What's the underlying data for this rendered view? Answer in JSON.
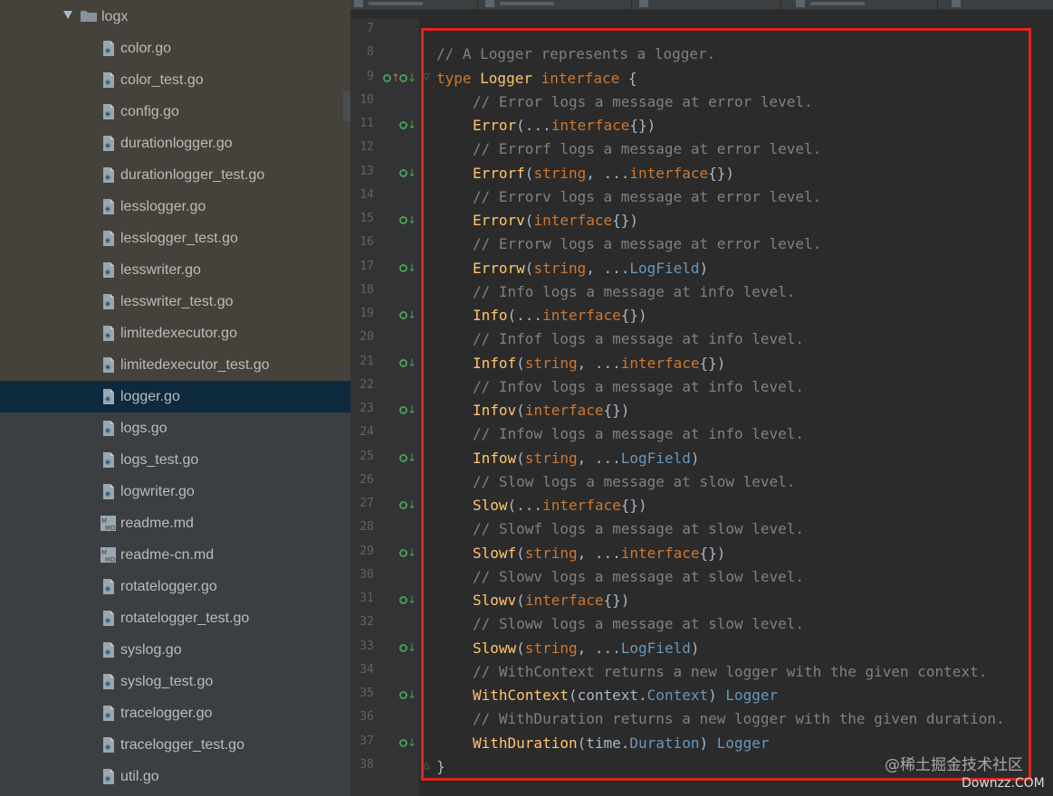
{
  "project_tree": {
    "folder": "logx",
    "selected": "logger.go",
    "files": [
      {
        "name": "color.go",
        "kind": "go"
      },
      {
        "name": "color_test.go",
        "kind": "go"
      },
      {
        "name": "config.go",
        "kind": "go"
      },
      {
        "name": "durationlogger.go",
        "kind": "go"
      },
      {
        "name": "durationlogger_test.go",
        "kind": "go"
      },
      {
        "name": "lesslogger.go",
        "kind": "go"
      },
      {
        "name": "lesslogger_test.go",
        "kind": "go"
      },
      {
        "name": "lesswriter.go",
        "kind": "go"
      },
      {
        "name": "lesswriter_test.go",
        "kind": "go"
      },
      {
        "name": "limitedexecutor.go",
        "kind": "go"
      },
      {
        "name": "limitedexecutor_test.go",
        "kind": "go"
      },
      {
        "name": "logger.go",
        "kind": "go"
      },
      {
        "name": "logs.go",
        "kind": "go"
      },
      {
        "name": "logs_test.go",
        "kind": "go"
      },
      {
        "name": "logwriter.go",
        "kind": "go"
      },
      {
        "name": "readme.md",
        "kind": "md"
      },
      {
        "name": "readme-cn.md",
        "kind": "md"
      },
      {
        "name": "rotatelogger.go",
        "kind": "go"
      },
      {
        "name": "rotatelogger_test.go",
        "kind": "go"
      },
      {
        "name": "syslog.go",
        "kind": "go"
      },
      {
        "name": "syslog_test.go",
        "kind": "go"
      },
      {
        "name": "tracelogger.go",
        "kind": "go"
      },
      {
        "name": "tracelogger_test.go",
        "kind": "go"
      },
      {
        "name": "util.go",
        "kind": "go"
      }
    ]
  },
  "editor": {
    "lines": [
      {
        "n": "7",
        "gutter": "",
        "tokens": []
      },
      {
        "n": "8",
        "gutter": "",
        "tokens": [
          {
            "t": "// A Logger represents a logger.",
            "c": "comment"
          }
        ]
      },
      {
        "n": "9",
        "gutter": "both",
        "tokens": [
          {
            "t": "type",
            "c": "keyword"
          },
          {
            "t": " Logger ",
            "c": "func"
          },
          {
            "t": "interface",
            "c": "keyword"
          },
          {
            "t": " {",
            "c": "plain"
          }
        ]
      },
      {
        "n": "10",
        "gutter": "",
        "indent": true,
        "tokens": [
          {
            "t": "// Error logs a message at error level.",
            "c": "comment"
          }
        ]
      },
      {
        "n": "11",
        "gutter": "down",
        "indent": true,
        "tokens": [
          {
            "t": "Error",
            "c": "func"
          },
          {
            "t": "(...",
            "c": "plain"
          },
          {
            "t": "interface",
            "c": "keyword"
          },
          {
            "t": "{})",
            "c": "plain"
          }
        ]
      },
      {
        "n": "12",
        "gutter": "",
        "indent": true,
        "tokens": [
          {
            "t": "// Errorf logs a message at error level.",
            "c": "comment"
          }
        ]
      },
      {
        "n": "13",
        "gutter": "down",
        "indent": true,
        "tokens": [
          {
            "t": "Errorf",
            "c": "func"
          },
          {
            "t": "(",
            "c": "plain"
          },
          {
            "t": "string",
            "c": "keyword"
          },
          {
            "t": ", ...",
            "c": "plain"
          },
          {
            "t": "interface",
            "c": "keyword"
          },
          {
            "t": "{})",
            "c": "plain"
          }
        ]
      },
      {
        "n": "14",
        "gutter": "",
        "indent": true,
        "tokens": [
          {
            "t": "// Errorv logs a message at error level.",
            "c": "comment"
          }
        ]
      },
      {
        "n": "15",
        "gutter": "down",
        "indent": true,
        "tokens": [
          {
            "t": "Errorv",
            "c": "func"
          },
          {
            "t": "(",
            "c": "plain"
          },
          {
            "t": "interface",
            "c": "keyword"
          },
          {
            "t": "{})",
            "c": "plain"
          }
        ]
      },
      {
        "n": "16",
        "gutter": "",
        "indent": true,
        "tokens": [
          {
            "t": "// Errorw logs a message at error level.",
            "c": "comment"
          }
        ]
      },
      {
        "n": "17",
        "gutter": "down",
        "indent": true,
        "tokens": [
          {
            "t": "Errorw",
            "c": "func"
          },
          {
            "t": "(",
            "c": "plain"
          },
          {
            "t": "string",
            "c": "keyword"
          },
          {
            "t": ", ...",
            "c": "plain"
          },
          {
            "t": "LogField",
            "c": "type"
          },
          {
            "t": ")",
            "c": "plain"
          }
        ]
      },
      {
        "n": "18",
        "gutter": "",
        "indent": true,
        "tokens": [
          {
            "t": "// Info logs a message at info level.",
            "c": "comment"
          }
        ]
      },
      {
        "n": "19",
        "gutter": "down",
        "indent": true,
        "tokens": [
          {
            "t": "Info",
            "c": "func"
          },
          {
            "t": "(...",
            "c": "plain"
          },
          {
            "t": "interface",
            "c": "keyword"
          },
          {
            "t": "{})",
            "c": "plain"
          }
        ]
      },
      {
        "n": "20",
        "gutter": "",
        "indent": true,
        "tokens": [
          {
            "t": "// Infof logs a message at info level.",
            "c": "comment"
          }
        ]
      },
      {
        "n": "21",
        "gutter": "down",
        "indent": true,
        "tokens": [
          {
            "t": "Infof",
            "c": "func"
          },
          {
            "t": "(",
            "c": "plain"
          },
          {
            "t": "string",
            "c": "keyword"
          },
          {
            "t": ", ...",
            "c": "plain"
          },
          {
            "t": "interface",
            "c": "keyword"
          },
          {
            "t": "{})",
            "c": "plain"
          }
        ]
      },
      {
        "n": "22",
        "gutter": "",
        "indent": true,
        "tokens": [
          {
            "t": "// Infov logs a message at info level.",
            "c": "comment"
          }
        ]
      },
      {
        "n": "23",
        "gutter": "down",
        "indent": true,
        "tokens": [
          {
            "t": "Infov",
            "c": "func"
          },
          {
            "t": "(",
            "c": "plain"
          },
          {
            "t": "interface",
            "c": "keyword"
          },
          {
            "t": "{})",
            "c": "plain"
          }
        ]
      },
      {
        "n": "24",
        "gutter": "",
        "indent": true,
        "tokens": [
          {
            "t": "// Infow logs a message at info level.",
            "c": "comment"
          }
        ]
      },
      {
        "n": "25",
        "gutter": "down",
        "indent": true,
        "tokens": [
          {
            "t": "Infow",
            "c": "func"
          },
          {
            "t": "(",
            "c": "plain"
          },
          {
            "t": "string",
            "c": "keyword"
          },
          {
            "t": ", ...",
            "c": "plain"
          },
          {
            "t": "LogField",
            "c": "type"
          },
          {
            "t": ")",
            "c": "plain"
          }
        ]
      },
      {
        "n": "26",
        "gutter": "",
        "indent": true,
        "tokens": [
          {
            "t": "// Slow logs a message at slow level.",
            "c": "comment"
          }
        ]
      },
      {
        "n": "27",
        "gutter": "down",
        "indent": true,
        "tokens": [
          {
            "t": "Slow",
            "c": "func"
          },
          {
            "t": "(...",
            "c": "plain"
          },
          {
            "t": "interface",
            "c": "keyword"
          },
          {
            "t": "{})",
            "c": "plain"
          }
        ]
      },
      {
        "n": "28",
        "gutter": "",
        "indent": true,
        "tokens": [
          {
            "t": "// Slowf logs a message at slow level.",
            "c": "comment"
          }
        ]
      },
      {
        "n": "29",
        "gutter": "down",
        "indent": true,
        "tokens": [
          {
            "t": "Slowf",
            "c": "func"
          },
          {
            "t": "(",
            "c": "plain"
          },
          {
            "t": "string",
            "c": "keyword"
          },
          {
            "t": ", ...",
            "c": "plain"
          },
          {
            "t": "interface",
            "c": "keyword"
          },
          {
            "t": "{})",
            "c": "plain"
          }
        ]
      },
      {
        "n": "30",
        "gutter": "",
        "indent": true,
        "tokens": [
          {
            "t": "// Slowv logs a message at slow level.",
            "c": "comment"
          }
        ]
      },
      {
        "n": "31",
        "gutter": "down",
        "indent": true,
        "tokens": [
          {
            "t": "Slowv",
            "c": "func"
          },
          {
            "t": "(",
            "c": "plain"
          },
          {
            "t": "interface",
            "c": "keyword"
          },
          {
            "t": "{})",
            "c": "plain"
          }
        ]
      },
      {
        "n": "32",
        "gutter": "",
        "indent": true,
        "tokens": [
          {
            "t": "// Sloww logs a message at slow level.",
            "c": "comment"
          }
        ]
      },
      {
        "n": "33",
        "gutter": "down",
        "indent": true,
        "tokens": [
          {
            "t": "Sloww",
            "c": "func"
          },
          {
            "t": "(",
            "c": "plain"
          },
          {
            "t": "string",
            "c": "keyword"
          },
          {
            "t": ", ...",
            "c": "plain"
          },
          {
            "t": "LogField",
            "c": "type"
          },
          {
            "t": ")",
            "c": "plain"
          }
        ]
      },
      {
        "n": "34",
        "gutter": "",
        "indent": true,
        "tokens": [
          {
            "t": "// WithContext returns a new logger with the given context.",
            "c": "comment"
          }
        ]
      },
      {
        "n": "35",
        "gutter": "down",
        "indent": true,
        "tokens": [
          {
            "t": "WithContext",
            "c": "func"
          },
          {
            "t": "(context.",
            "c": "plain"
          },
          {
            "t": "Context",
            "c": "type"
          },
          {
            "t": ") ",
            "c": "plain"
          },
          {
            "t": "Logger",
            "c": "type"
          }
        ]
      },
      {
        "n": "36",
        "gutter": "",
        "indent": true,
        "tokens": [
          {
            "t": "// WithDuration returns a new logger with the given duration.",
            "c": "comment"
          }
        ]
      },
      {
        "n": "37",
        "gutter": "down",
        "indent": true,
        "tokens": [
          {
            "t": "WithDuration",
            "c": "func"
          },
          {
            "t": "(time.",
            "c": "plain"
          },
          {
            "t": "Duration",
            "c": "type"
          },
          {
            "t": ") ",
            "c": "plain"
          },
          {
            "t": "Logger",
            "c": "type"
          }
        ]
      },
      {
        "n": "38",
        "gutter": "",
        "tokens": [
          {
            "t": "}",
            "c": "plain"
          }
        ]
      }
    ]
  },
  "watermark": "@稀土掘金技术社区",
  "site_mark": "Downzz.COM",
  "colors": {
    "comment": "#808080",
    "keyword": "#cc7832",
    "func": "#ffc66d",
    "type": "#6897bb",
    "plain": "#a9b7c6",
    "highlight_border": "#e0241e",
    "gutter_mark": "#499c54",
    "selection": "#0d293e"
  },
  "icons": {
    "go_file": "go-file-icon",
    "md_file": "markdown-file-icon",
    "folder": "folder-icon"
  }
}
